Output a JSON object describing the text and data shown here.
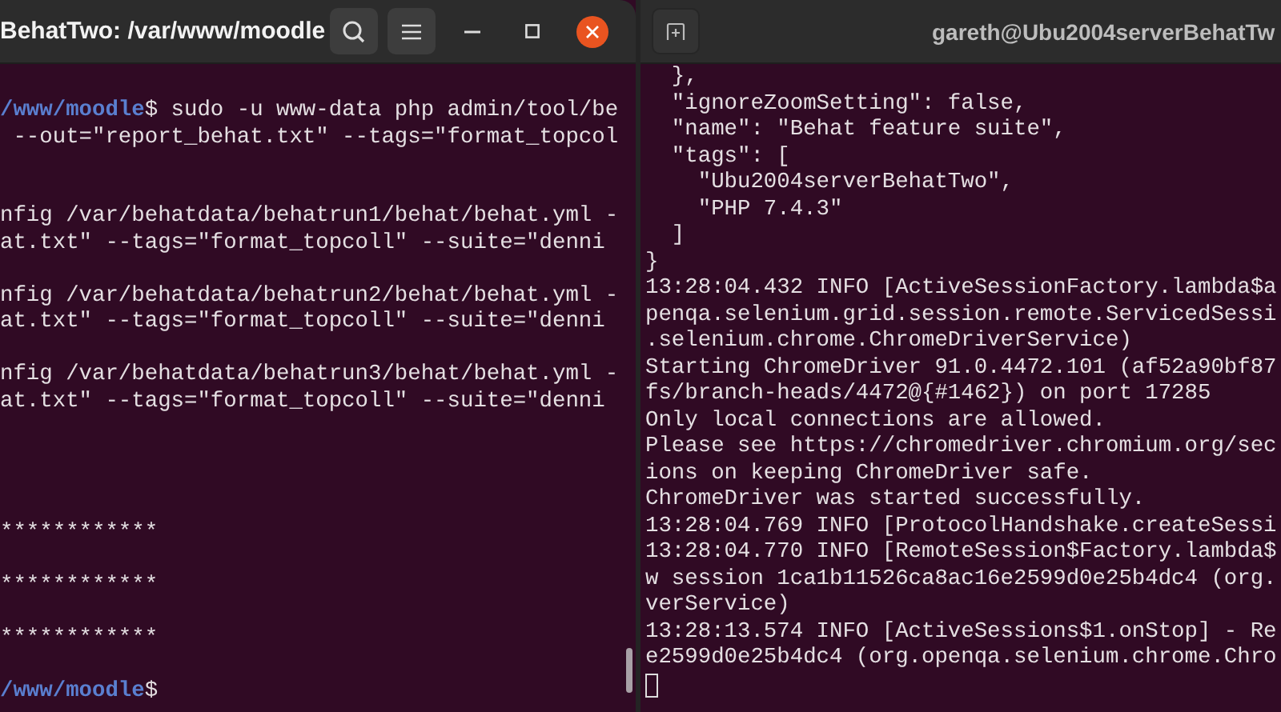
{
  "left_terminal": {
    "title": "BehatTwo: /var/www/moodle",
    "lines": [
      {
        "kind": "prompt",
        "path": "/www/moodle",
        "symbol": "$",
        "command": " sudo -u www-data php admin/tool/be"
      },
      {
        "kind": "output",
        "text": " --out=\"report_behat.txt\" --tags=\"format_topcol"
      },
      {
        "kind": "blank"
      },
      {
        "kind": "blank"
      },
      {
        "kind": "output",
        "text": "nfig /var/behatdata/behatrun1/behat/behat.yml -"
      },
      {
        "kind": "output",
        "text": "at.txt\" --tags=\"format_topcoll\" --suite=\"denni"
      },
      {
        "kind": "blank"
      },
      {
        "kind": "output",
        "text": "nfig /var/behatdata/behatrun2/behat/behat.yml -"
      },
      {
        "kind": "output",
        "text": "at.txt\" --tags=\"format_topcoll\" --suite=\"denni"
      },
      {
        "kind": "blank"
      },
      {
        "kind": "output",
        "text": "nfig /var/behatdata/behatrun3/behat/behat.yml -"
      },
      {
        "kind": "output",
        "text": "at.txt\" --tags=\"format_topcoll\" --suite=\"denni"
      },
      {
        "kind": "blank"
      },
      {
        "kind": "blank"
      },
      {
        "kind": "blank"
      },
      {
        "kind": "blank"
      },
      {
        "kind": "output",
        "text": "************"
      },
      {
        "kind": "blank"
      },
      {
        "kind": "output",
        "text": "************"
      },
      {
        "kind": "blank"
      },
      {
        "kind": "output",
        "text": "************"
      },
      {
        "kind": "blank"
      },
      {
        "kind": "prompt",
        "path": "/www/moodle",
        "symbol": "$"
      }
    ]
  },
  "right_terminal": {
    "title": "gareth@Ubu2004serverBehatTw",
    "lines": [
      "  },",
      "  \"ignoreZoomSetting\": false,",
      "  \"name\": \"Behat feature suite\",",
      "  \"tags\": [",
      "    \"Ubu2004serverBehatTwo\",",
      "    \"PHP 7.4.3\"",
      "  ]",
      "}",
      "13:28:04.432 INFO [ActiveSessionFactory.lambda$a",
      "penqa.selenium.grid.session.remote.ServicedSessi",
      ".selenium.chrome.ChromeDriverService)",
      "Starting ChromeDriver 91.0.4472.101 (af52a90bf87",
      "fs/branch-heads/4472@{#1462}) on port 17285",
      "Only local connections are allowed.",
      "Please see https://chromedriver.chromium.org/sec",
      "ions on keeping ChromeDriver safe.",
      "ChromeDriver was started successfully.",
      "13:28:04.769 INFO [ProtocolHandshake.createSessi",
      "13:28:04.770 INFO [RemoteSession$Factory.lambda$",
      "w session 1ca1b11526ca8ac16e2599d0e25b4dc4 (org.",
      "verService)",
      "13:28:13.574 INFO [ActiveSessions$1.onStop] - Re",
      "e2599d0e25b4dc4 (org.openqa.selenium.chrome.Chro"
    ]
  }
}
